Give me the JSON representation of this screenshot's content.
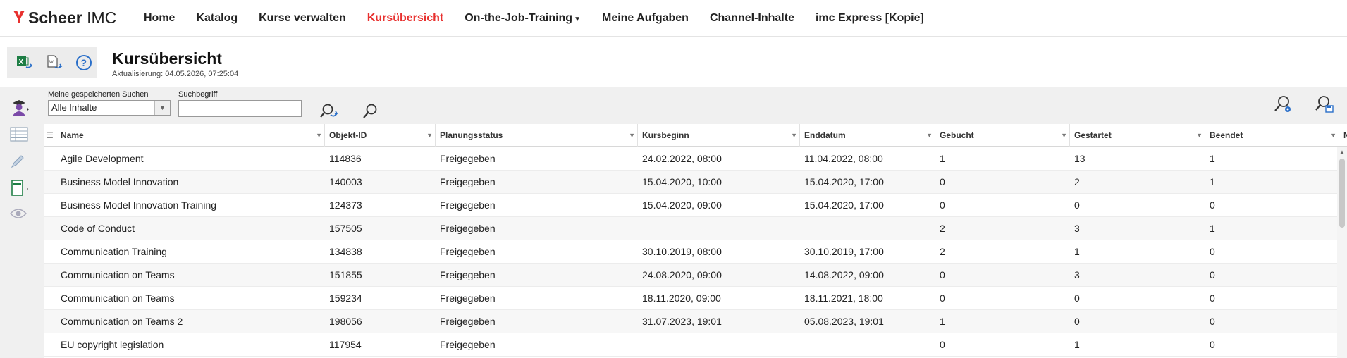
{
  "brand": {
    "mark": "Y",
    "name_bold": "Scheer",
    "name_rest": " IMC"
  },
  "nav": {
    "items": [
      {
        "label": "Home"
      },
      {
        "label": "Katalog"
      },
      {
        "label": "Kurse verwalten"
      },
      {
        "label": "Kursübersicht"
      },
      {
        "label": "On-the-Job-Training"
      },
      {
        "label": "Meine Aufgaben"
      },
      {
        "label": "Channel-Inhalte"
      },
      {
        "label": "imc Express [Kopie]"
      }
    ],
    "active": "Kursübersicht",
    "accent_color": "#e8312f"
  },
  "header": {
    "title": "Kursübersicht",
    "subtitle": "Aktualisierung: 04.05.2026, 07:25:04",
    "tools": [
      "excel-export-icon",
      "document-export-icon",
      "help-icon"
    ]
  },
  "search": {
    "saved_label": "Meine gespeicherten Suchen",
    "saved_value": "Alle Inhalte",
    "term_label": "Suchbegriff",
    "term_value": ""
  },
  "table": {
    "columns": [
      "Name",
      "Objekt-ID",
      "Planungsstatus",
      "Kursbeginn",
      "Enddatum",
      "Gebucht",
      "Gestartet",
      "Beendet",
      "N"
    ],
    "rows": [
      [
        "Agile Development",
        "114836",
        "Freigegeben",
        "24.02.2022, 08:00",
        "11.04.2022, 08:00",
        "1",
        "13",
        "1"
      ],
      [
        "Business Model Innovation",
        "140003",
        "Freigegeben",
        "15.04.2020, 10:00",
        "15.04.2020, 17:00",
        "0",
        "2",
        "1"
      ],
      [
        "Business Model Innovation Training",
        "124373",
        "Freigegeben",
        "15.04.2020, 09:00",
        "15.04.2020, 17:00",
        "0",
        "0",
        "0"
      ],
      [
        "Code of Conduct",
        "157505",
        "Freigegeben",
        "",
        "",
        "2",
        "3",
        "1"
      ],
      [
        "Communication Training",
        "134838",
        "Freigegeben",
        "30.10.2019, 08:00",
        "30.10.2019, 17:00",
        "2",
        "1",
        "0"
      ],
      [
        "Communication on Teams",
        "151855",
        "Freigegeben",
        "24.08.2020, 09:00",
        "14.08.2022, 09:00",
        "0",
        "3",
        "0"
      ],
      [
        "Communication on Teams",
        "159234",
        "Freigegeben",
        "18.11.2020, 09:00",
        "18.11.2021, 18:00",
        "0",
        "0",
        "0"
      ],
      [
        "Communication on Teams 2",
        "198056",
        "Freigegeben",
        "31.07.2023, 19:01",
        "05.08.2023, 19:01",
        "1",
        "0",
        "0"
      ],
      [
        "EU copyright legislation",
        "117954",
        "Freigegeben",
        "",
        "",
        "0",
        "1",
        "0"
      ]
    ]
  }
}
